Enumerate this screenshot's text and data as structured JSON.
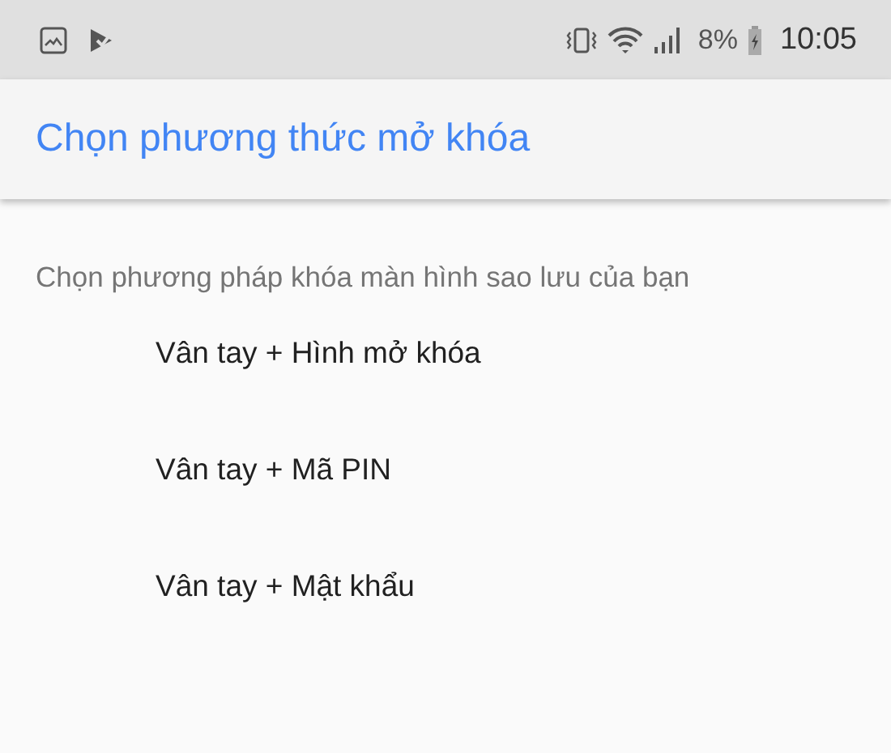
{
  "status_bar": {
    "battery": "8%",
    "time": "10:05"
  },
  "header": {
    "title": "Chọn phương thức mở khóa"
  },
  "subtitle": "Chọn phương pháp khóa màn hình sao lưu của bạn",
  "options": [
    {
      "label": "Vân tay + Hình mở khóa"
    },
    {
      "label": "Vân tay + Mã PIN"
    },
    {
      "label": "Vân tay + Mật khẩu"
    }
  ]
}
